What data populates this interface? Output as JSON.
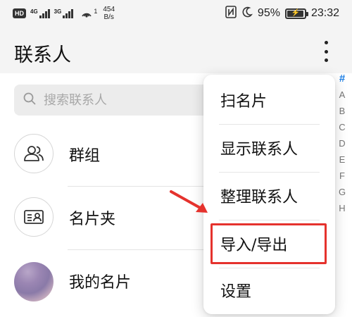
{
  "status_bar": {
    "hd_badge": "HD",
    "net1_label": "4G",
    "net2_label": "3G",
    "hotspot_count": "1",
    "speed_value": "454",
    "speed_unit": "B/s",
    "battery_percent": "95%",
    "battery_level": 0.95,
    "time": "23:32",
    "icons": [
      "nfc-icon",
      "moon-icon",
      "battery-icon",
      "hotspot-icon",
      "signal-icon"
    ]
  },
  "header": {
    "title": "联系人"
  },
  "search": {
    "placeholder": "搜索联系人"
  },
  "list": [
    {
      "label": "群组",
      "icon": "group-icon"
    },
    {
      "label": "名片夹",
      "icon": "card-holder-icon"
    },
    {
      "label": "我的名片",
      "icon": "profile-photo"
    }
  ],
  "alphabet_index": [
    "#",
    "A",
    "B",
    "C",
    "D",
    "E",
    "F",
    "G",
    "H"
  ],
  "menu": {
    "items": [
      "扫名片",
      "显示联系人",
      "整理联系人",
      "导入/导出",
      "设置"
    ],
    "highlighted_index": 3
  },
  "colors": {
    "accent": "#1a7ee6",
    "highlight_red": "#e5322d",
    "background": "#f4f4f4"
  }
}
